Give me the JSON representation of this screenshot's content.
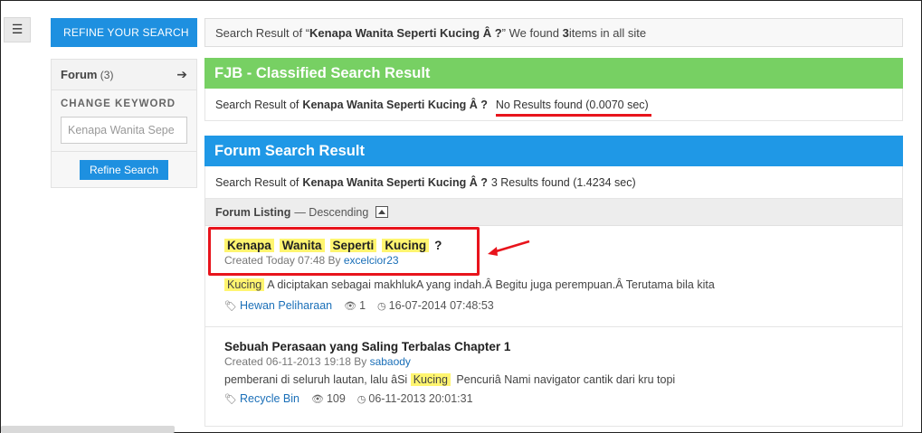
{
  "menu_icon": "hamburger-icon",
  "sidebar": {
    "refine_tab": "REFINE YOUR SEARCH",
    "forum_label": "Forum",
    "forum_count": "(3)",
    "change_keyword": "CHANGE KEYWORD",
    "keyword_value": "Kenapa Wanita Sepe",
    "refine_button": "Refine Search"
  },
  "topbar": {
    "prefix": "Search Result of “",
    "query": "Kenapa Wanita Seperti Kucing Â ?",
    "middle": "” We found ",
    "count": "3",
    "suffix": " items in all site"
  },
  "fjb": {
    "title": "FJB - Classified Search Result",
    "prefix": "Search Result of",
    "query": "Kenapa Wanita Seperti Kucing Â ?",
    "status": "No Results found (0.0070 sec)"
  },
  "forum": {
    "title": "Forum Search Result",
    "prefix": "Search Result of",
    "query": "Kenapa Wanita Seperti Kucing Â ?",
    "status": "3 Results found (1.4234 sec)",
    "listing_label": "Forum Listing",
    "listing_order": "— Descending",
    "results": [
      {
        "title_words": [
          "Kenapa",
          "Wanita",
          "Seperti",
          "Kucing"
        ],
        "title_tail": "?",
        "created": "Created Today 07:48 By ",
        "author": "excelcior23",
        "snippet_hl": "Kucing",
        "snippet": "A diciptakan sebagai makhlukA yang indah.Â Begitu juga perempuan.Â Terutama bila kita",
        "tag": "Hewan Peliharaan",
        "views": "1",
        "date": "16-07-2014 07:48:53"
      },
      {
        "title": "Sebuah Perasaan yang Saling Terbalas Chapter 1",
        "created": "Created 06-11-2013 19:18 By ",
        "author": "sabaody",
        "snippet_pre": "pemberani di seluruh lautan, lalu âSi",
        "snippet_hl": "Kucing",
        "snippet_post": "Pencuriâ Nami navigator cantik dari kru topi",
        "tag": "Recycle Bin",
        "views": "109",
        "date": "06-11-2013 20:01:31"
      }
    ]
  }
}
